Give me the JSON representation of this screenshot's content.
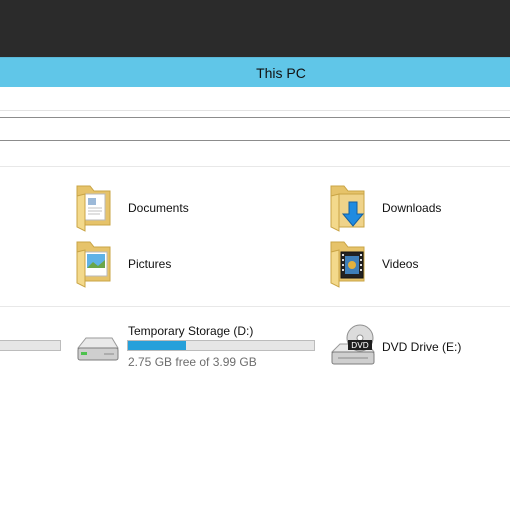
{
  "window": {
    "title": "This PC"
  },
  "folders": [
    {
      "label": "Documents",
      "icon": "documents-folder-icon"
    },
    {
      "label": "Downloads",
      "icon": "downloads-folder-icon"
    },
    {
      "label": "Pictures",
      "icon": "pictures-folder-icon"
    },
    {
      "label": "Videos",
      "icon": "videos-folder-icon"
    }
  ],
  "devices": {
    "partial_drive": {
      "usage_fraction": 0.0
    },
    "temporary_storage": {
      "name": "Temporary Storage (D:)",
      "free_text": "2.75 GB free of 3.99 GB",
      "usage_fraction": 0.31,
      "icon": "hard-drive-icon"
    },
    "dvd_drive": {
      "name": "DVD Drive (E:)",
      "icon": "dvd-drive-icon",
      "badge": "DVD"
    }
  },
  "colors": {
    "topbar": "#2b2b2b",
    "titlebar": "#60c6e8",
    "usage_bar": "#26a0da"
  }
}
